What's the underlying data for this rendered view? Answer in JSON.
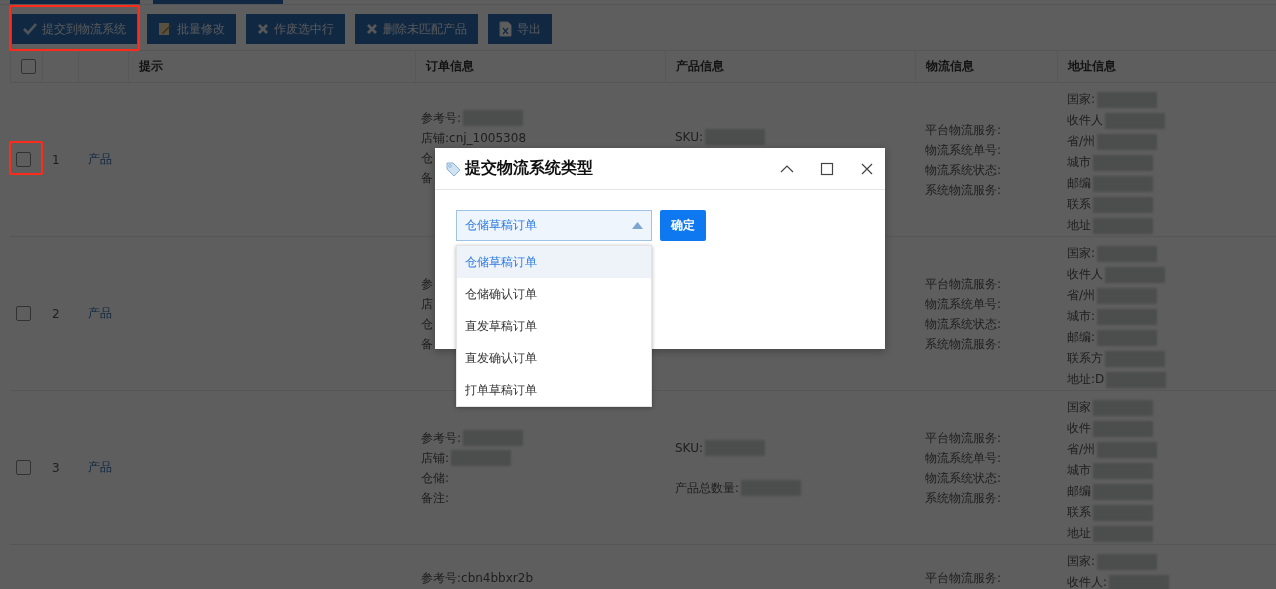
{
  "toolbar": {
    "buttons": [
      {
        "label": "提交到物流系统",
        "highlighted": true
      },
      {
        "label": "批量修改",
        "highlighted": false
      },
      {
        "label": "作废选中行",
        "highlighted": false
      },
      {
        "label": "删除未匹配产品",
        "highlighted": false
      },
      {
        "label": "导出",
        "highlighted": false
      }
    ]
  },
  "table": {
    "header_checked": false,
    "columns": [
      "提示",
      "订单信息",
      "产品信息",
      "物流信息",
      "地址信息"
    ],
    "rows": [
      {
        "index": "1",
        "checked": false,
        "highlighted": true,
        "hint": "产品",
        "order_info": [
          {
            "text": "参考号:",
            "redacted": true
          },
          {
            "text": "店铺:cnj_1005308",
            "redacted": false
          },
          {
            "text": "仓"
          },
          {
            "text": "备"
          }
        ],
        "product_info": [
          {
            "text": "SKU:",
            "redacted": true
          }
        ],
        "logistics_info": [
          "平台物流服务:",
          "物流系统单号:",
          "物流系统状态:",
          "系统物流服务:"
        ],
        "address_info": [
          {
            "text": "国家:",
            "redacted": true
          },
          {
            "text": "收件人",
            "redacted": true
          },
          {
            "text": "省/州",
            "redacted": true
          },
          {
            "text": "城市",
            "redacted": true
          },
          {
            "text": "邮编",
            "redacted": true
          },
          {
            "text": "联系",
            "redacted": true
          },
          {
            "text": "地址",
            "redacted": true
          }
        ]
      },
      {
        "index": "2",
        "checked": false,
        "highlighted": false,
        "hint": "产品",
        "order_info": [
          {
            "text": "参"
          },
          {
            "text": "店"
          },
          {
            "text": "仓"
          },
          {
            "text": "备"
          }
        ],
        "product_info": [],
        "logistics_info": [
          "平台物流服务:",
          "物流系统单号:",
          "物流系统状态:",
          "系统物流服务:"
        ],
        "address_info": [
          {
            "text": "国家:",
            "redacted": true
          },
          {
            "text": "收件人",
            "redacted": true
          },
          {
            "text": "省/州",
            "redacted": true
          },
          {
            "text": "城市:",
            "redacted": true
          },
          {
            "text": "邮编:",
            "redacted": true
          },
          {
            "text": "联系方",
            "redacted": true
          },
          {
            "text": "地址:D",
            "redacted": true
          }
        ]
      },
      {
        "index": "3",
        "checked": false,
        "highlighted": false,
        "hint": "产品",
        "order_info": [
          {
            "text": "参考号:",
            "redacted": true
          },
          {
            "text": "店铺:",
            "redacted": true
          },
          {
            "text": "仓储:",
            "redacted": false
          },
          {
            "text": "备注:",
            "redacted": false
          }
        ],
        "product_info": [
          {
            "text": "SKU:",
            "redacted": true
          },
          {
            "text": "产品总数量:",
            "redacted": true
          }
        ],
        "logistics_info": [
          "平台物流服务:",
          "物流系统单号:",
          "物流系统状态:",
          "系统物流服务:"
        ],
        "address_info": [
          {
            "text": "国家",
            "redacted": true
          },
          {
            "text": "收件",
            "redacted": true
          },
          {
            "text": "省/州",
            "redacted": true
          },
          {
            "text": "城市",
            "redacted": true
          },
          {
            "text": "邮编",
            "redacted": true
          },
          {
            "text": "联系",
            "redacted": true
          },
          {
            "text": "地址",
            "redacted": true
          }
        ]
      },
      {
        "order_info": [
          {
            "text": "参考号:cbn4bbxr2b",
            "redacted": false
          }
        ],
        "product_info": [],
        "logistics_info": [
          "平台物流服务:"
        ],
        "address_info": [
          {
            "text": "国家:",
            "redacted": true
          },
          {
            "text": "收件人:",
            "redacted": true
          }
        ]
      }
    ]
  },
  "dialog": {
    "title": "提交物流系统类型",
    "select": {
      "value": "仓储草稿订单",
      "expanded": true
    },
    "confirm": "确定",
    "options": [
      {
        "label": "仓储草稿订单",
        "selected": true
      },
      {
        "label": "仓储确认订单",
        "selected": false
      },
      {
        "label": "直发草稿订单",
        "selected": false
      },
      {
        "label": "直发确认订单",
        "selected": false
      },
      {
        "label": "打单草稿订单",
        "selected": false
      }
    ]
  }
}
